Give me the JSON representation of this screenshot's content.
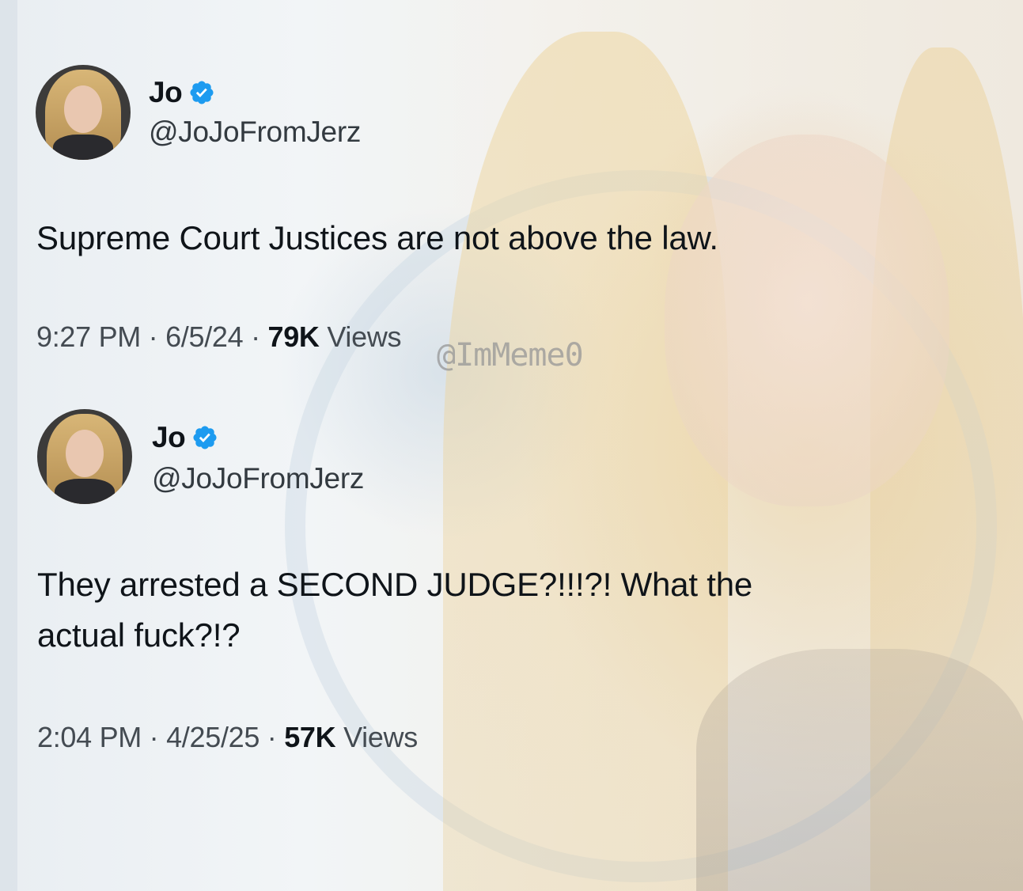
{
  "watermark": "@ImMeme0",
  "tweets": [
    {
      "author": {
        "name": "Jo",
        "handle": "@JoJoFromJerz",
        "verified_icon": "verified-badge-icon",
        "verified_color": "#1d9bf0"
      },
      "text": "Supreme Court Justices are not above the law.",
      "time": "9:27 PM",
      "date": "6/5/24",
      "separator": "·",
      "views_count": "79K",
      "views_label": "Views"
    },
    {
      "author": {
        "name": "Jo",
        "handle": "@JoJoFromJerz",
        "verified_icon": "verified-badge-icon",
        "verified_color": "#1d9bf0"
      },
      "text": "They arrested a SECOND JUDGE?!!!?! What the actual fuck?!?",
      "time": "2:04 PM",
      "date": "4/25/25",
      "separator": "·",
      "views_count": "57K",
      "views_label": "Views"
    }
  ]
}
